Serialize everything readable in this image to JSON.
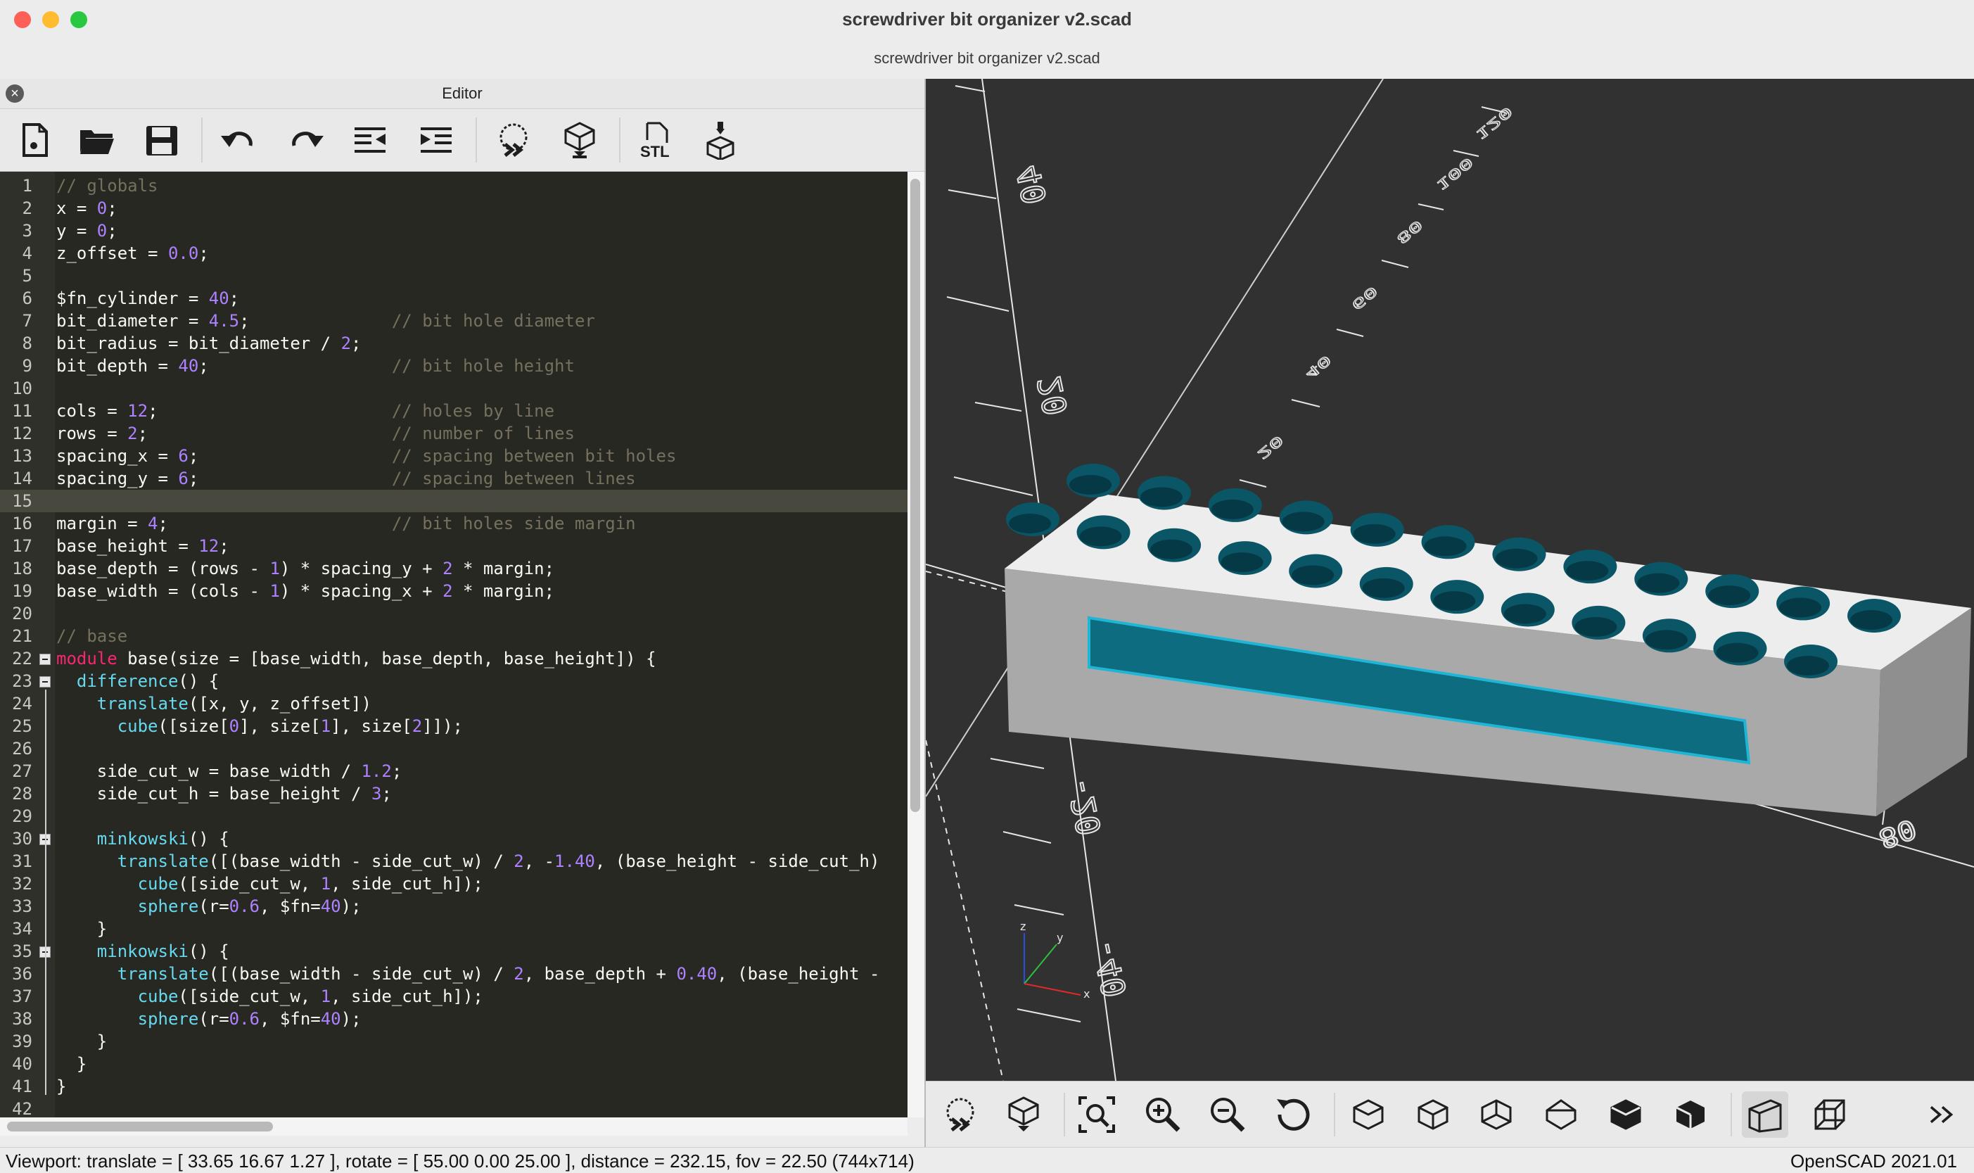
{
  "window": {
    "title": "screwdriver bit organizer v2.scad",
    "tab_title": "screwdriver bit organizer v2.scad"
  },
  "editor": {
    "label": "Editor",
    "toolbar": [
      "new-file-icon",
      "open-file-icon",
      "save-icon",
      "undo-icon",
      "redo-icon",
      "unindent-icon",
      "indent-icon",
      "preview-icon",
      "render-icon",
      "export-stl-icon",
      "send-to-printer-icon"
    ],
    "stl_label": "STL",
    "line_numbers": [
      "1",
      "2",
      "3",
      "4",
      "5",
      "6",
      "7",
      "8",
      "9",
      "10",
      "11",
      "12",
      "13",
      "14",
      "15",
      "16",
      "17",
      "18",
      "19",
      "20",
      "21",
      "22",
      "23",
      "24",
      "25",
      "26",
      "27",
      "28",
      "29",
      "30",
      "31",
      "32",
      "33",
      "34",
      "35",
      "36",
      "37",
      "38",
      "39",
      "40",
      "41",
      "42"
    ],
    "lines": [
      "// globals",
      "x = 0;",
      "y = 0;",
      "z_offset = 0.0;",
      "",
      "$fn_cylinder = 40;",
      "bit_diameter = 4.5;              // bit hole diameter",
      "bit_radius = bit_diameter / 2;",
      "bit_depth = 40;                  // bit hole height",
      "",
      "cols = 12;                       // holes by line",
      "rows = 2;                        // number of lines",
      "spacing_x = 6;                   // spacing between bit holes",
      "spacing_y = 6;                   // spacing between lines",
      "",
      "margin = 4;                      // bit holes side margin",
      "base_height = 12;",
      "base_depth = (rows - 1) * spacing_y + 2 * margin;",
      "base_width = (cols - 1) * spacing_x + 2 * margin;",
      "",
      "// base",
      "module base(size = [base_width, base_depth, base_height]) {",
      "  difference() {",
      "    translate([x, y, z_offset])",
      "      cube([size[0], size[1], size[2]]);",
      "",
      "    side_cut_w = base_width / 1.2;",
      "    side_cut_h = base_height / 3;",
      "",
      "    minkowski() {",
      "      translate([(base_width - side_cut_w) / 2, -1.40, (base_height - side_cut_h)",
      "        cube([side_cut_w, 1, side_cut_h]);",
      "        sphere(r=0.6, $fn=40);",
      "    }",
      "    minkowski() {",
      "      translate([(base_width - side_cut_w) / 2, base_depth + 0.40, (base_height -",
      "        cube([side_cut_w, 1, side_cut_h]);",
      "        sphere(r=0.6, $fn=40);",
      "    }",
      "  }",
      "}",
      ""
    ],
    "highlighted_line": 15,
    "fold_lines": [
      22,
      23,
      30,
      35
    ]
  },
  "viewport": {
    "axis_labels": [
      "40",
      "20",
      "-20",
      "-40",
      "20",
      "40",
      "60",
      "80",
      "100",
      "120",
      "80"
    ],
    "mini_axes": [
      "z",
      "y",
      "x"
    ],
    "colors": {
      "background": "#313131",
      "model_top": "#ededed",
      "model_side": "#a5a5a5",
      "cut": "#0e6f84",
      "cut_edge": "#1fb6d6"
    }
  },
  "view_toolbar": [
    "preview-icon",
    "render-icon",
    "view-all-icon",
    "zoom-in-icon",
    "zoom-out-icon",
    "reset-view-icon",
    "view-right-icon",
    "view-top-icon",
    "view-bottom-icon",
    "view-left-icon",
    "view-front-icon",
    "view-back-icon",
    "perspective-icon",
    "orthogonal-icon",
    "more-icon"
  ],
  "status": {
    "viewport": "Viewport: translate = [ 33.65 16.67 1.27 ], rotate = [ 55.00 0.00 25.00 ], distance = 232.15, fov = 22.50 (744x714)",
    "version": "OpenSCAD 2021.01"
  }
}
